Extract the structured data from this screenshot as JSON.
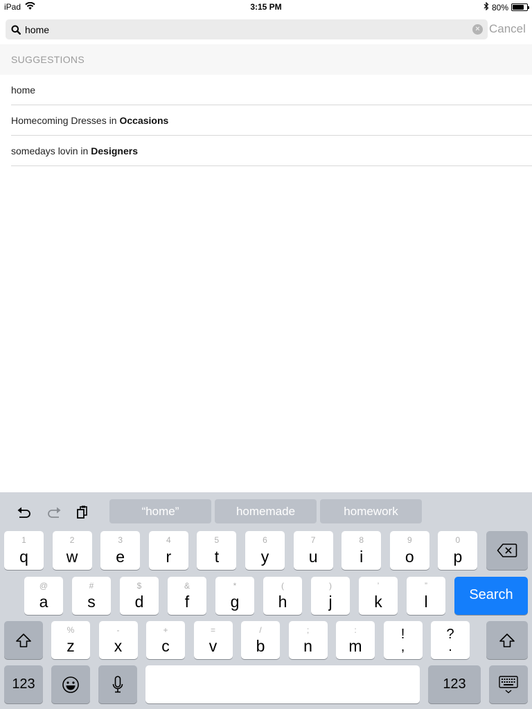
{
  "status_bar": {
    "device": "iPad",
    "time": "3:15 PM",
    "battery_percent": "80%",
    "battery_level": 0.8
  },
  "search": {
    "value": "home",
    "placeholder": "",
    "cancel_label": "Cancel"
  },
  "suggestions": {
    "header": "SUGGESTIONS",
    "items": [
      {
        "text": "home",
        "category": ""
      },
      {
        "text": "Homecoming Dresses in",
        "category": "Occasions"
      },
      {
        "text": "somedays lovin in",
        "category": "Designers"
      }
    ]
  },
  "keyboard": {
    "predictions": [
      "“home”",
      "homemade",
      "homework"
    ],
    "row1": [
      {
        "main": "q",
        "sub": "1"
      },
      {
        "main": "w",
        "sub": "2"
      },
      {
        "main": "e",
        "sub": "3"
      },
      {
        "main": "r",
        "sub": "4"
      },
      {
        "main": "t",
        "sub": "5"
      },
      {
        "main": "y",
        "sub": "6"
      },
      {
        "main": "u",
        "sub": "7"
      },
      {
        "main": "i",
        "sub": "8"
      },
      {
        "main": "o",
        "sub": "9"
      },
      {
        "main": "p",
        "sub": "0"
      }
    ],
    "row2": [
      {
        "main": "a",
        "sub": "@"
      },
      {
        "main": "s",
        "sub": "#"
      },
      {
        "main": "d",
        "sub": "$"
      },
      {
        "main": "f",
        "sub": "&"
      },
      {
        "main": "g",
        "sub": "*"
      },
      {
        "main": "h",
        "sub": "("
      },
      {
        "main": "j",
        "sub": ")"
      },
      {
        "main": "k",
        "sub": "’"
      },
      {
        "main": "l",
        "sub": "”"
      }
    ],
    "row3": [
      {
        "main": "z",
        "sub": "%"
      },
      {
        "main": "x",
        "sub": "-"
      },
      {
        "main": "c",
        "sub": "+"
      },
      {
        "main": "v",
        "sub": "="
      },
      {
        "main": "b",
        "sub": "/"
      },
      {
        "main": "n",
        "sub": ";"
      },
      {
        "main": "m",
        "sub": ":"
      },
      {
        "main": ",",
        "sub": "!"
      },
      {
        "main": ".",
        "sub": "?"
      }
    ],
    "search_label": "Search",
    "numbers_label": "123",
    "space_label": ""
  },
  "colors": {
    "accent": "#147efb",
    "keyboard_bg": "#d1d5db",
    "dark_key": "#adb3bc"
  }
}
